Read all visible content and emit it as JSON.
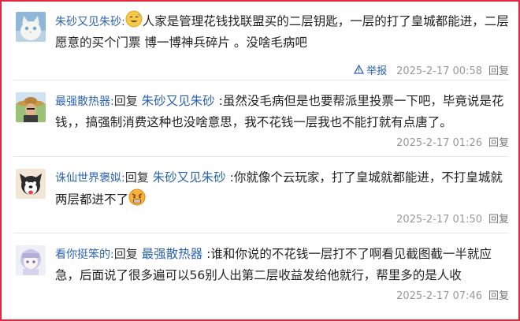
{
  "posts": [
    {
      "user": "朱砂又见朱砂:",
      "text_line": "人家是管理花钱找联盟买的二层钥匙，一层的打了皇城都能进，二层愿意的买个门票 博一博神兵碎片 。没啥毛病吧",
      "report_label": "举报",
      "time": "2025-2-17 00:58",
      "reply_label": "回复",
      "avatar_icon": "white-cat-avatar",
      "emoji_icon": "sweat-smile-emoji"
    },
    {
      "user": "最强散热器:",
      "reply_word": "回复",
      "mention": "朱砂又见朱砂",
      "text": " :虽然没毛病但是也要帮派里投票一下吧，毕竟说是花钱，，搞强制消费这种也没啥意思，我不花钱一层我也不能打就有点唐了。",
      "time": "2025-2-17 01:26",
      "reply_label": "回复",
      "avatar_icon": "man-with-straw-hat-avatar"
    },
    {
      "user": "诛仙世界褒姒:",
      "reply_word": "回复",
      "mention": "朱砂又见朱砂",
      "text": " :你就像个云玩家，打了皇城就都能进，不打皇城就两层都进不了",
      "time": "2025-2-17 01:50",
      "reply_label": "回复",
      "avatar_icon": "dog-avatar",
      "emoji_icon": "angry-emoji"
    },
    {
      "user": "看你挺笨的:",
      "reply_word": "回复",
      "mention": "最强散热器",
      "text": " :谁和你说的不花钱一层打不了啊看见截图截一半就应急，后面说了很多遍可以56别人出第二层收益发给他就行，帮里多的是人收",
      "time": "2025-2-17 07:46",
      "reply_label": "回复",
      "avatar_icon": "anime-girl-avatar"
    }
  ],
  "colors": {
    "link": "#2d64b3",
    "border": "#e0283f",
    "meta": "#999999"
  }
}
